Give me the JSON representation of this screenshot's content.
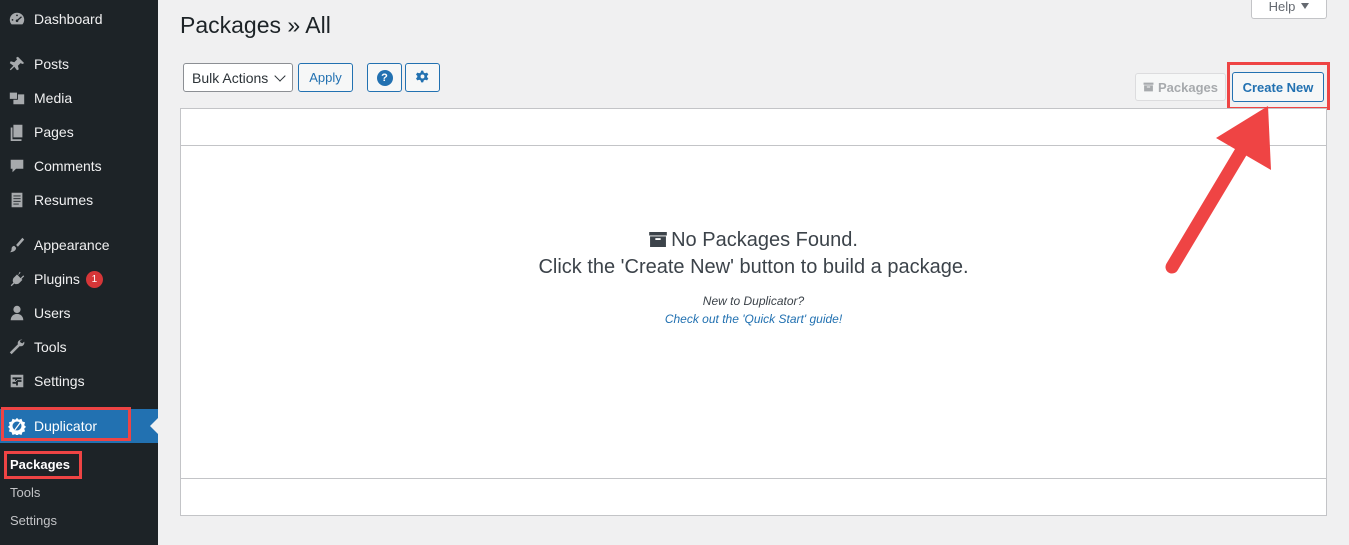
{
  "sidebar": {
    "items": [
      {
        "label": "Dashboard",
        "icon": "dashboard-icon"
      },
      {
        "label": "Posts",
        "icon": "pin-icon"
      },
      {
        "label": "Media",
        "icon": "media-icon"
      },
      {
        "label": "Pages",
        "icon": "pages-icon"
      },
      {
        "label": "Comments",
        "icon": "comment-icon"
      },
      {
        "label": "Resumes",
        "icon": "document-icon"
      },
      {
        "label": "Appearance",
        "icon": "paintbrush-icon"
      },
      {
        "label": "Plugins",
        "icon": "plugin-icon",
        "badge": "1"
      },
      {
        "label": "Users",
        "icon": "user-icon"
      },
      {
        "label": "Tools",
        "icon": "wrench-icon"
      },
      {
        "label": "Settings",
        "icon": "settings-icon"
      },
      {
        "label": "Duplicator",
        "icon": "duplicator-icon"
      }
    ],
    "submenu": [
      {
        "label": "Packages"
      },
      {
        "label": "Tools"
      },
      {
        "label": "Settings"
      }
    ]
  },
  "header": {
    "title": "Packages » All",
    "help_label": "Help"
  },
  "toolbar": {
    "bulk_actions": "Bulk Actions",
    "apply_label": "Apply",
    "help_icon_glyph": "?",
    "packages_label": "Packages",
    "create_new_label": "Create New"
  },
  "empty_state": {
    "title": "No Packages Found.",
    "subtitle": "Click the 'Create New' button to build a package.",
    "hint": "New to Duplicator?",
    "link": "Check out the 'Quick Start' guide!"
  },
  "colors": {
    "sidebar_bg": "#1d2327",
    "accent": "#2271b1",
    "highlight_box": "#e44444",
    "badge": "#d63638"
  }
}
